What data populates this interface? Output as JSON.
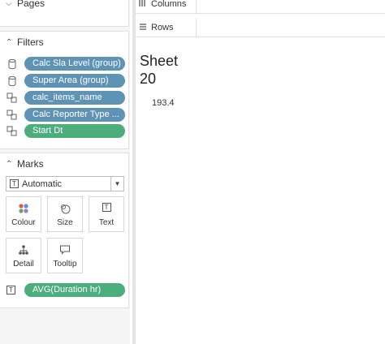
{
  "pages": {
    "title": "Pages"
  },
  "filters": {
    "title": "Filters",
    "items": [
      {
        "label": "Calc Sla Level (group)",
        "icon": "cylinder-icon"
      },
      {
        "label": "Super Area (group)",
        "icon": "cylinder-icon"
      },
      {
        "label": "calc_items_name",
        "icon": "linked-field-icon"
      },
      {
        "label": "Calc Reporter Type ...",
        "icon": "linked-field-icon"
      },
      {
        "label": "Start Dt",
        "icon": "linked-field-icon"
      }
    ]
  },
  "marks": {
    "title": "Marks",
    "type_selected": "Automatic",
    "buttons": [
      {
        "label": "Colour",
        "icon": "colour-dots-icon"
      },
      {
        "label": "Size",
        "icon": "size-circles-icon"
      },
      {
        "label": "Text",
        "icon": "text-t-icon"
      },
      {
        "label": "Detail",
        "icon": "detail-nodes-icon"
      },
      {
        "label": "Tooltip",
        "icon": "speech-bubble-icon"
      }
    ],
    "text_field": "AVG(Duration hr)"
  },
  "shelves": {
    "columns_label": "Columns",
    "rows_label": "Rows"
  },
  "sheet": {
    "title_line1": "Sheet",
    "title_line2": "20",
    "value": "193.4"
  },
  "colors": {
    "pill_blue": "#5f93b6",
    "pill_green": "#4cae7d"
  }
}
